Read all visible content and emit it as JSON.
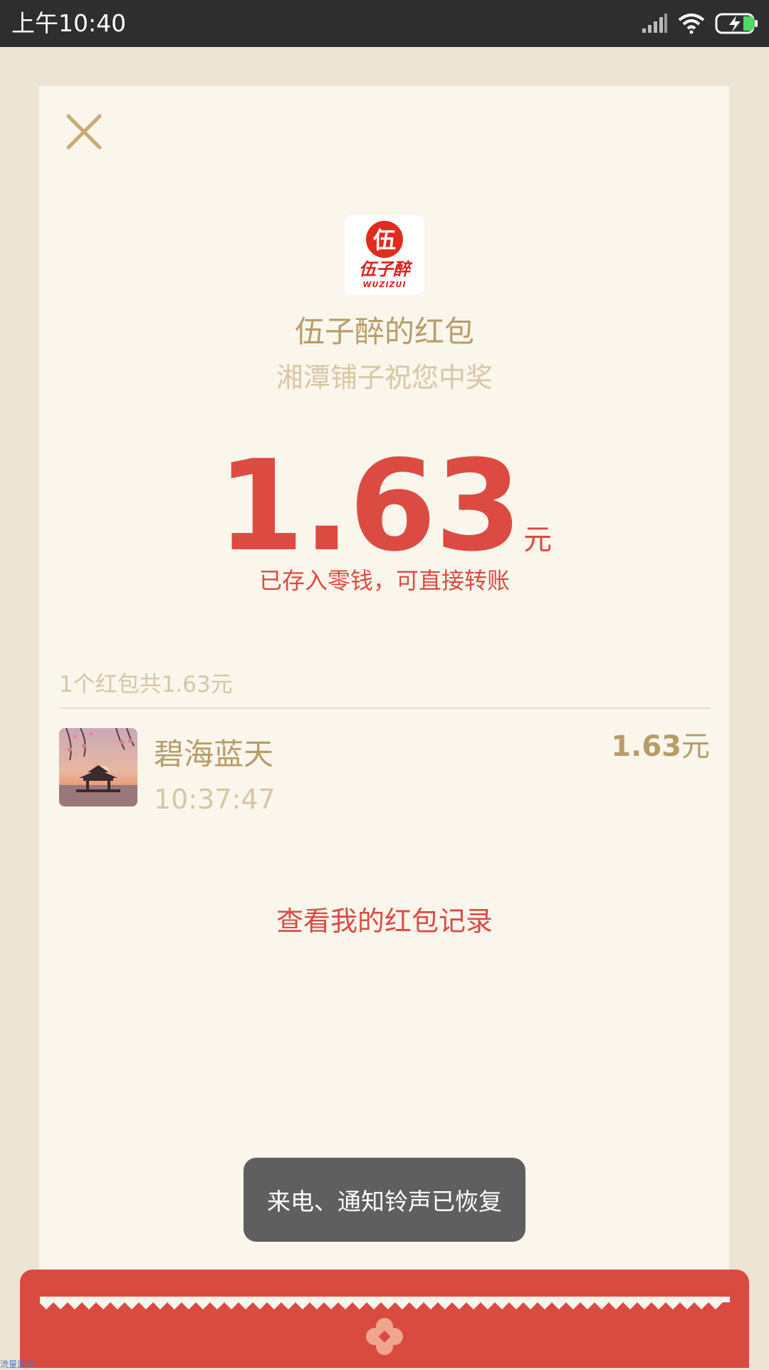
{
  "status_bar": {
    "time": "上午10:40",
    "icons": [
      "signal-icon",
      "wifi-icon",
      "battery-charging-icon"
    ]
  },
  "header": {
    "close_icon": "close-icon",
    "logo": {
      "brand_name": "伍子醉",
      "brand_pinyin": "WUZIZUI",
      "mark": "伍"
    }
  },
  "packet": {
    "title": "伍子醉的红包",
    "wish": "湘潭铺子祝您中奖",
    "amount": "1.63",
    "unit": "元",
    "saved_note": "已存入零钱，可直接转账"
  },
  "summary": {
    "text": "1个红包共1.63元"
  },
  "recipients": [
    {
      "name": "碧海蓝天",
      "time": "10:37:47",
      "amount": "1.63",
      "unit": "元"
    }
  ],
  "actions": {
    "history_link": "查看我的红包记录"
  },
  "toast": {
    "message": "来电、通知铃声已恢复"
  },
  "corner_text": "流量监控",
  "colors": {
    "accent_red": "#dc4b41",
    "gold": "#b89c68",
    "card_bg": "#faf6ec",
    "page_bg": "#ede4d3"
  }
}
